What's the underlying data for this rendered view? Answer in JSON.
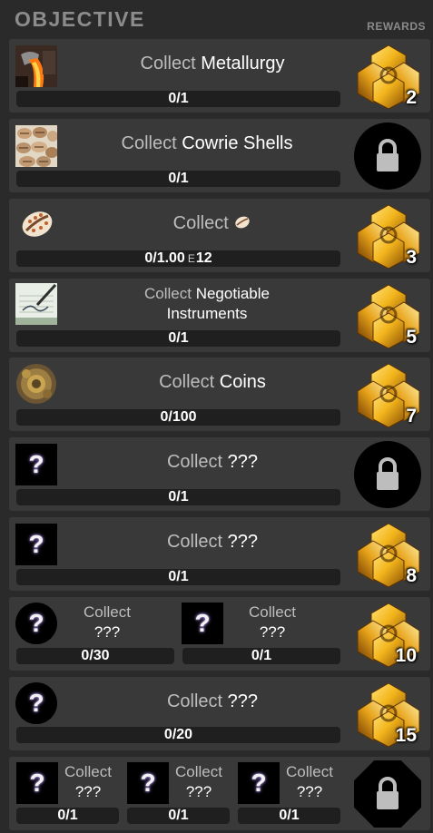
{
  "header": {
    "title": "OBJECTIVE",
    "rewards_label": "REWARDS"
  },
  "rows": [
    {
      "collect": "Collect",
      "name": "Metallurgy",
      "progress": "0/1",
      "reward": "2",
      "locked": false,
      "icon": "metallurgy-icon"
    },
    {
      "collect": "Collect",
      "name": "Cowrie Shells",
      "progress": "0/1",
      "locked": true,
      "icon": "cowrie-shells-icon"
    },
    {
      "collect": "Collect",
      "progress_main": "0/1.00",
      "progress_exp": "E",
      "progress_tail": "12",
      "reward": "3",
      "locked": false,
      "icon": "cowrie-shell-icon"
    },
    {
      "collect": "Collect",
      "name_line1": "Negotiable",
      "name_line2": "Instruments",
      "progress": "0/1",
      "reward": "5",
      "locked": false,
      "icon": "negotiable-instruments-icon"
    },
    {
      "collect": "Collect",
      "name": "Coins",
      "progress": "0/100",
      "reward": "7",
      "locked": false,
      "icon": "coins-icon"
    },
    {
      "collect": "Collect",
      "name": "???",
      "progress": "0/1",
      "locked": true,
      "icon": "unknown-icon"
    },
    {
      "collect": "Collect",
      "name": "???",
      "progress": "0/1",
      "reward": "8",
      "locked": false,
      "icon": "unknown-icon"
    },
    {
      "reward": "10",
      "locked": false,
      "subs": [
        {
          "collect": "Collect",
          "name": "???",
          "progress": "0/30",
          "icon": "unknown-icon"
        },
        {
          "collect": "Collect",
          "name": "???",
          "progress": "0/1",
          "icon": "unknown-icon"
        }
      ]
    },
    {
      "collect": "Collect",
      "name": "???",
      "progress": "0/20",
      "reward": "15",
      "locked": false,
      "icon": "unknown-icon"
    },
    {
      "locked": true,
      "subs": [
        {
          "collect": "Collect",
          "name": "???",
          "progress": "0/1",
          "icon": "unknown-icon"
        },
        {
          "collect": "Collect",
          "name": "???",
          "progress": "0/1",
          "icon": "unknown-icon"
        },
        {
          "collect": "Collect",
          "name": "???",
          "progress": "0/1",
          "icon": "unknown-icon"
        }
      ]
    }
  ],
  "question_mark": "?",
  "colors": {
    "background": "#2a2a2a",
    "row": "#393939",
    "bar": "#1f1f1f",
    "keyword": "#bdbdbd",
    "reward_gold": "#f3b51c"
  }
}
